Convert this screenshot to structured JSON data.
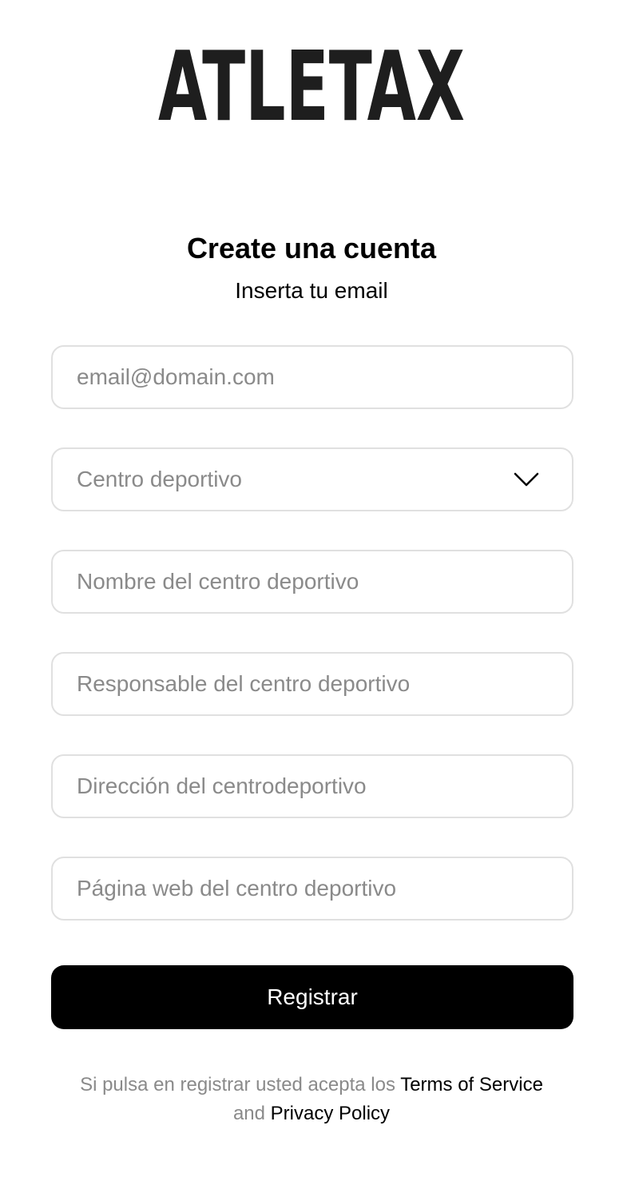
{
  "logo": {
    "text": "ATLETAX"
  },
  "header": {
    "title": "Create una cuenta",
    "subtitle": "Inserta tu email"
  },
  "form": {
    "email": {
      "placeholder": "email@domain.com",
      "value": ""
    },
    "center_type": {
      "selected": "Centro deportivo",
      "icon": "chevron-down-icon"
    },
    "center_name": {
      "placeholder": "Nombre del centro deportivo",
      "value": ""
    },
    "center_manager": {
      "placeholder": "Responsable del centro deportivo",
      "value": ""
    },
    "center_address": {
      "placeholder": "Dirección del centrodeportivo",
      "value": ""
    },
    "center_website": {
      "placeholder": "Página web del centro deportivo",
      "value": ""
    },
    "submit_label": "Registrar"
  },
  "legal": {
    "prefix": "Si pulsa en registrar usted acepta los",
    "terms_label": "Terms of Service",
    "conjunction": "and",
    "privacy_label": "Privacy Policy"
  },
  "colors": {
    "primary": "#000000",
    "border": "#e0e0e0",
    "placeholder": "#8a8a8a",
    "background": "#ffffff",
    "logo": "#1e1e1e"
  }
}
